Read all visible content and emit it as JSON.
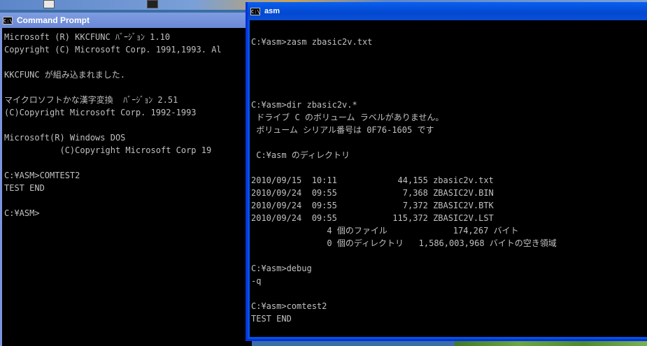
{
  "left_window": {
    "title": "Command Prompt",
    "icon": "console-icon",
    "icon_text": "C:\\",
    "lines": [
      "Microsoft (R) KKCFUNC ﾊﾞｰｼﾞｮﾝ 1.10",
      "Copyright (C) Microsoft Corp. 1991,1993. Al",
      "",
      "KKCFUNC が組み込まれました.",
      "",
      "マイクロソフトかな漢字変換  ﾊﾞｰｼﾞｮﾝ 2.51",
      "(C)Copyright Microsoft Corp. 1992-1993",
      "",
      "Microsoft(R) Windows DOS",
      "           (C)Copyright Microsoft Corp 19",
      "",
      "C:¥ASM>COMTEST2",
      "TEST END",
      "",
      "C:¥ASM>"
    ]
  },
  "right_window": {
    "title": "asm",
    "icon": "console-icon",
    "icon_text": "C:\\",
    "lines": [
      "",
      "C:¥asm>zasm zbasic2v.txt",
      "",
      "",
      "",
      "",
      "C:¥asm>dir zbasic2v.*",
      " ドライブ C のボリューム ラベルがありません。",
      " ボリューム シリアル番号は 0F76-1605 です",
      "",
      " C:¥asm のディレクトリ",
      "",
      "2010/09/15  10:11            44,155 zbasic2v.txt",
      "2010/09/24  09:55             7,368 ZBASIC2V.BIN",
      "2010/09/24  09:55             7,372 ZBASIC2V.BTK",
      "2010/09/24  09:55           115,372 ZBASIC2V.LST",
      "               4 個のファイル             174,267 バイト",
      "               0 個のディレクトリ   1,586,003,968 バイトの空き領域",
      "",
      "C:¥asm>debug",
      "-q",
      "",
      "C:¥asm>comtest2",
      "TEST END",
      "",
      "C:¥asm>"
    ]
  }
}
